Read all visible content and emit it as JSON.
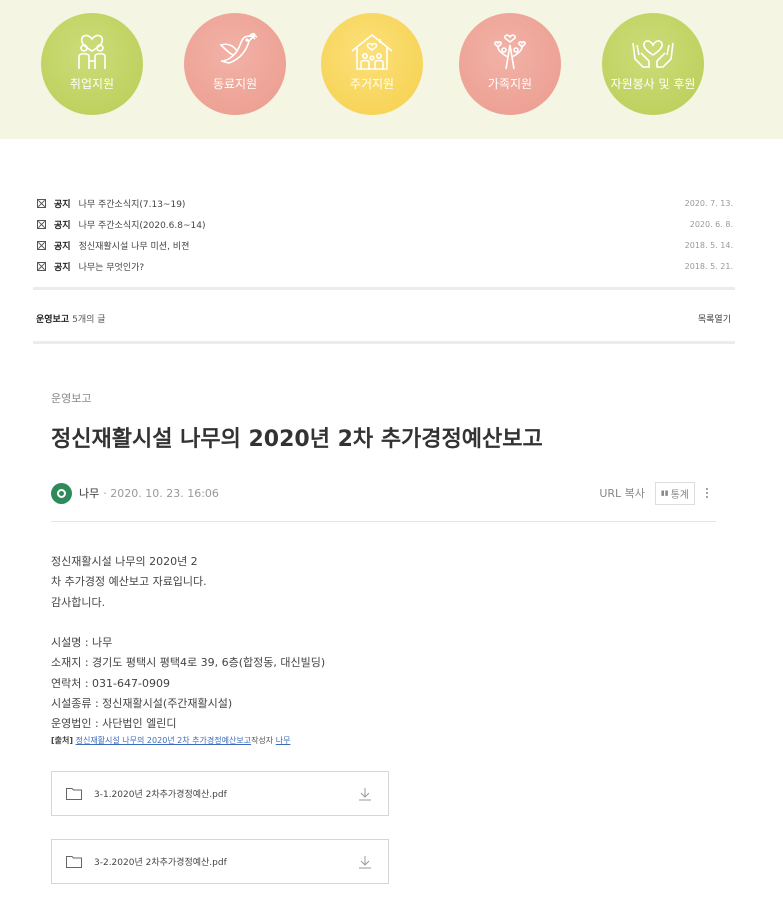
{
  "banner": {
    "items": [
      {
        "label": "취업지원",
        "icon": "family-icon",
        "color": "#c5d66a"
      },
      {
        "label": "동료지원",
        "icon": "dove-icon",
        "color": "#f0a99c"
      },
      {
        "label": "주거지원",
        "icon": "house-icon",
        "color": "#f9d95f"
      },
      {
        "label": "가족지원",
        "icon": "heart-tree-icon",
        "color": "#f0a99c"
      },
      {
        "label": "자원봉사 및 후원",
        "icon": "hands-heart-icon",
        "color": "#c5d66a"
      }
    ]
  },
  "notices": [
    {
      "tag": "공지",
      "title": "나무 주간소식지(7.13~19)",
      "date": "2020. 7. 13."
    },
    {
      "tag": "공지",
      "title": "나무 주간소식지(2020.6.8~14)",
      "date": "2020. 6. 8."
    },
    {
      "tag": "공지",
      "title": "정신재활시설 나무 미션, 비젼",
      "date": "2018. 5. 14."
    },
    {
      "tag": "공지",
      "title": "나무는 무엇인가?",
      "date": "2018. 5. 21."
    }
  ],
  "category_bar": {
    "name": "운영보고",
    "count": "5개의 글",
    "toggle": "목록열기"
  },
  "post": {
    "category": "운영보고",
    "title": "정신재활시설 나무의 2020년 2차 추가경정예산보고",
    "author": "나무",
    "date": "· 2020. 10. 23. 16:06",
    "url_copy": "URL 복사",
    "stats": "통계",
    "body": [
      "정신재활시설 나무의 2020년 2",
      "차 추가경정 예산보고 자료입니다.",
      "감사합니다.",
      "시설명 : 나무",
      "소재지 : 경기도 평택시 평택4로 39, 6층(합정동, 대신빌딩)",
      "연락처 : 031-647-0909",
      "시설종류 : 정신재활시설(주간재활시설)",
      "운영법인 : 사단법인 엘린디"
    ],
    "source": {
      "prefix": "[출처]",
      "link": "정신재활시설 나무의 2020년 2차 추가경정예산보고",
      "author_label": "작성자",
      "author": "나무"
    },
    "files": [
      {
        "name": "3-1.2020년 2차추가경정예산.pdf"
      },
      {
        "name": "3-2.2020년 2차추가경정예산.pdf"
      }
    ]
  }
}
